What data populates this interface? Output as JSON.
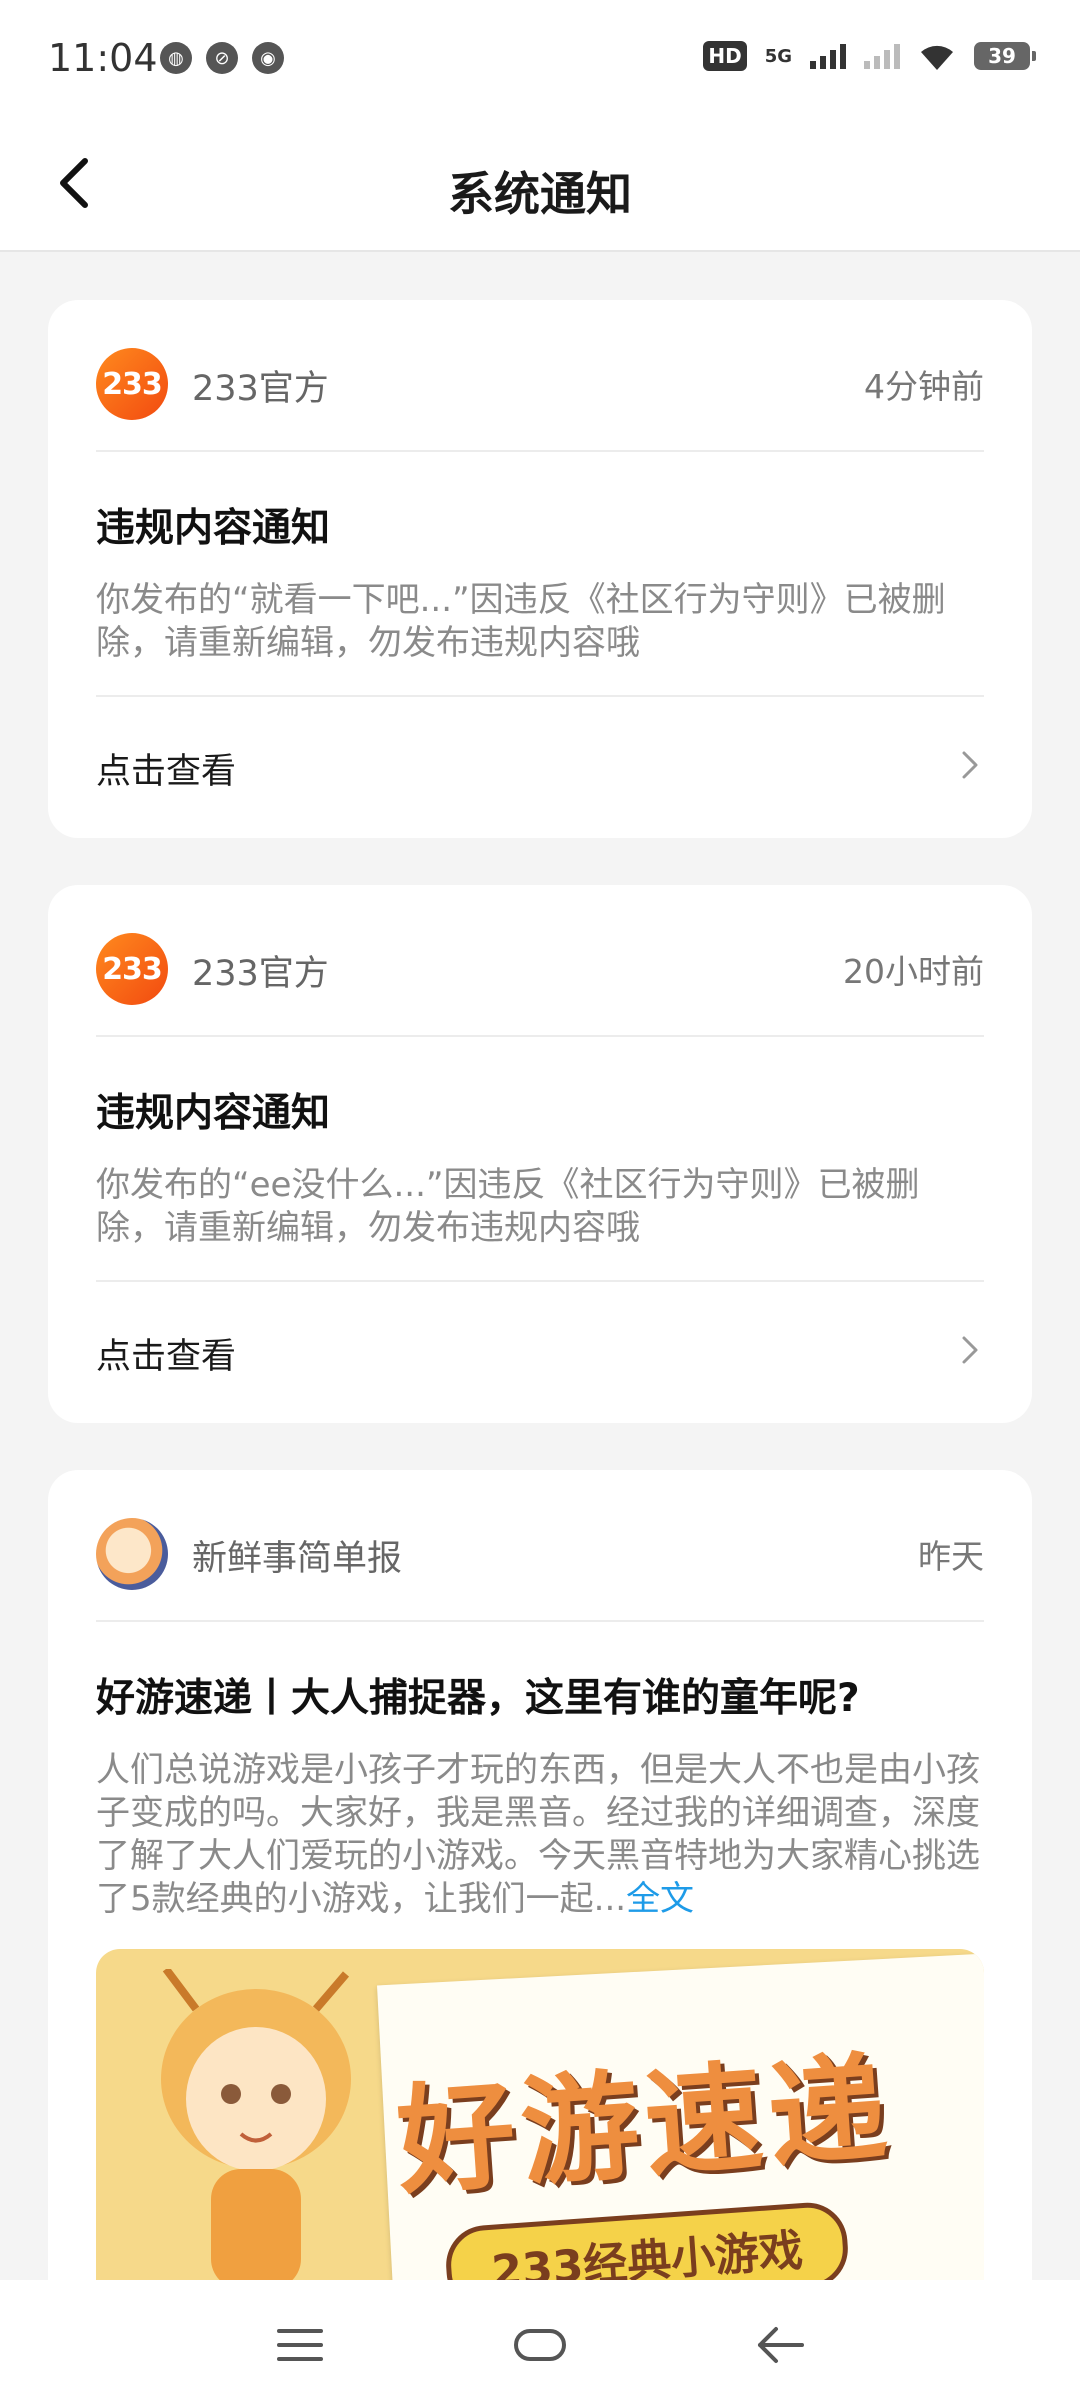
{
  "status_bar": {
    "time": "11:04",
    "hd_label": "HD",
    "network_label": "5G",
    "battery": "39",
    "app_icons": [
      "wechat-icon",
      "link-icon",
      "camera-icon"
    ]
  },
  "header": {
    "title": "系统通知",
    "back_icon": "chevron-left-icon"
  },
  "notifications": [
    {
      "source": "233官方",
      "avatar_text": "233",
      "time": "4分钟前",
      "title": "违规内容通知",
      "body": "你发布的“就看一下吧...”因违反《社区行为守则》已被删除，请重新编辑，勿发布违规内容哦",
      "action": "点击查看"
    },
    {
      "source": "233官方",
      "avatar_text": "233",
      "time": "20小时前",
      "title": "违规内容通知",
      "body": "你发布的“ee没什么...”因违反《社区行为守则》已被删除，请重新编辑，勿发布违规内容哦",
      "action": "点击查看"
    },
    {
      "source": "新鲜事简单报",
      "time": "昨天",
      "title": "好游速递丨大人捕捉器，这里有谁的童年呢?",
      "body": "人们总说游戏是小孩子才玩的东西，但是大人不也是由小孩子变成的吗。大家好，我是黑音。经过我的详细调查，深度了解了大人们爱玩的小游戏。今天黑音特地为大家精心挑选了5款经典的小游戏，让我们一起...",
      "more_link": "全文",
      "banner_title": "好游速递",
      "banner_subtitle": "233经典小游戏"
    }
  ],
  "colors": {
    "accent_orange": "#f24a10",
    "link_blue": "#1e9be8"
  }
}
